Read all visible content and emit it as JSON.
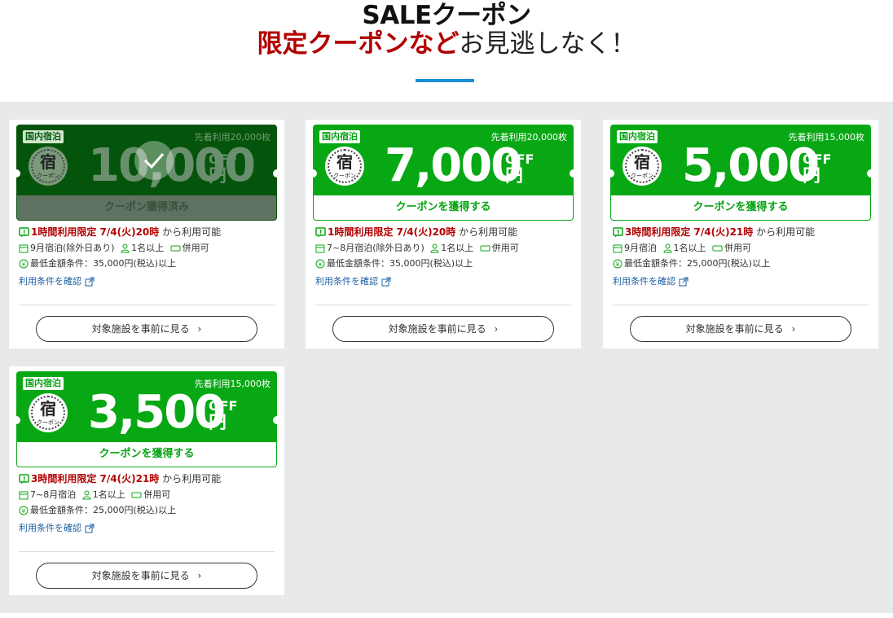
{
  "header": {
    "title": "SALEクーポン",
    "subtitle_highlight": "限定クーポンなど",
    "subtitle_rest": "お見逃しなく！"
  },
  "cards": [
    {
      "tag": "国内宿泊",
      "limit": "先着利用20,000枚",
      "stamp_char": "宿",
      "stamp_sub": "クーポン",
      "amount": "10,000",
      "off": "OFF",
      "yen": "円",
      "button": "クーポン獲得済み",
      "acquired": true,
      "time_limit": "1時間利用限定 7/4(火)20時",
      "time_rest": "から利用可能",
      "period": "9月宿泊(除外日あり)",
      "persons": "1名以上",
      "combine": "併用可",
      "min_amount": "最低金額条件：35,000円(税込)以上",
      "terms_link": "利用条件を確認",
      "view_button": "対象施設を事前に見る"
    },
    {
      "tag": "国内宿泊",
      "limit": "先着利用20,000枚",
      "stamp_char": "宿",
      "stamp_sub": "クーポン",
      "amount": "7,000",
      "off": "OFF",
      "yen": "円",
      "button": "クーポンを獲得する",
      "acquired": false,
      "time_limit": "1時間利用限定 7/4(火)20時",
      "time_rest": "から利用可能",
      "period": "7~8月宿泊(除外日あり)",
      "persons": "1名以上",
      "combine": "併用可",
      "min_amount": "最低金額条件：35,000円(税込)以上",
      "terms_link": "利用条件を確認",
      "view_button": "対象施設を事前に見る"
    },
    {
      "tag": "国内宿泊",
      "limit": "先着利用15,000枚",
      "stamp_char": "宿",
      "stamp_sub": "クーポン",
      "amount": "5,000",
      "off": "OFF",
      "yen": "円",
      "button": "クーポンを獲得する",
      "acquired": false,
      "time_limit": "3時間利用限定 7/4(火)21時",
      "time_rest": "から利用可能",
      "period": "9月宿泊",
      "persons": "1名以上",
      "combine": "併用可",
      "min_amount": "最低金額条件：25,000円(税込)以上",
      "terms_link": "利用条件を確認",
      "view_button": "対象施設を事前に見る"
    },
    {
      "tag": "国内宿泊",
      "limit": "先着利用15,000枚",
      "stamp_char": "宿",
      "stamp_sub": "クーポン",
      "amount": "3,500",
      "off": "OFF",
      "yen": "円",
      "button": "クーポンを獲得する",
      "acquired": false,
      "time_limit": "3時間利用限定 7/4(火)21時",
      "time_rest": "から利用可能",
      "period": "7~8月宿泊",
      "persons": "1名以上",
      "combine": "併用可",
      "min_amount": "最低金額条件：25,000円(税込)以上",
      "terms_link": "利用条件を確認",
      "view_button": "対象施設を事前に見る"
    }
  ],
  "colors": {
    "green": "#08a815",
    "dark_green": "#05540b",
    "red": "#b20000",
    "accent_bar": "#1a8fd6",
    "link": "#1b5fa3"
  }
}
